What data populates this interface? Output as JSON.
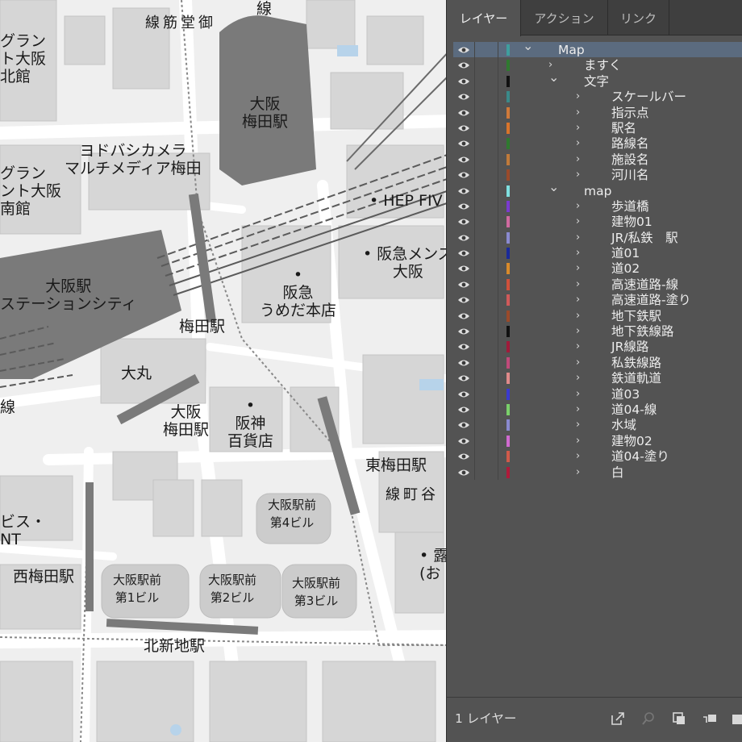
{
  "panel": {
    "tabs": [
      {
        "label": "レイヤー",
        "active": true
      },
      {
        "label": "アクション",
        "active": false
      },
      {
        "label": "リンク",
        "active": false
      }
    ],
    "layers": [
      {
        "name": "Map",
        "level": 0,
        "expanded": true,
        "color": "#3f9e9e",
        "selected": true
      },
      {
        "name": "ますく",
        "level": 1,
        "expanded": false,
        "color": "#2f7a2f"
      },
      {
        "name": "文字",
        "level": 1,
        "expanded": true,
        "color": "#111111"
      },
      {
        "name": "スケールバー",
        "level": 2,
        "expanded": false,
        "color": "#3a8a8a"
      },
      {
        "name": "指示点",
        "level": 2,
        "expanded": false,
        "color": "#d07a3a"
      },
      {
        "name": "駅名",
        "level": 2,
        "expanded": false,
        "color": "#d9742a"
      },
      {
        "name": "路線名",
        "level": 2,
        "expanded": false,
        "color": "#2f7a2f"
      },
      {
        "name": "施設名",
        "level": 2,
        "expanded": false,
        "color": "#c07a3a"
      },
      {
        "name": "河川名",
        "level": 2,
        "expanded": false,
        "color": "#9a4a2a"
      },
      {
        "name": "map",
        "level": 1,
        "expanded": true,
        "color": "#7fe0e0"
      },
      {
        "name": "歩道橋",
        "level": 2,
        "expanded": false,
        "color": "#7a3ad0"
      },
      {
        "name": "建物01",
        "level": 2,
        "expanded": false,
        "color": "#d06aa0"
      },
      {
        "name": "JR/私鉄　駅",
        "level": 2,
        "expanded": false,
        "color": "#8a8ad0"
      },
      {
        "name": "道01",
        "level": 2,
        "expanded": false,
        "color": "#1a2a9a"
      },
      {
        "name": "道02",
        "level": 2,
        "expanded": false,
        "color": "#d88a2a"
      },
      {
        "name": "高速道路-線",
        "level": 2,
        "expanded": false,
        "color": "#d0503a"
      },
      {
        "name": "高速道路-塗り",
        "level": 2,
        "expanded": false,
        "color": "#d05a5a"
      },
      {
        "name": "地下鉄駅",
        "level": 2,
        "expanded": false,
        "color": "#9a4a2a"
      },
      {
        "name": "地下鉄線路",
        "level": 2,
        "expanded": false,
        "color": "#111111"
      },
      {
        "name": "JR線路",
        "level": 2,
        "expanded": false,
        "color": "#a01a3a"
      },
      {
        "name": "私鉄線路",
        "level": 2,
        "expanded": false,
        "color": "#c04a7a"
      },
      {
        "name": "鉄道軌道",
        "level": 2,
        "expanded": false,
        "color": "#e08a8a"
      },
      {
        "name": "道03",
        "level": 2,
        "expanded": false,
        "color": "#3a3ad0"
      },
      {
        "name": "道04-線",
        "level": 2,
        "expanded": false,
        "color": "#7ad06a"
      },
      {
        "name": "水域",
        "level": 2,
        "expanded": false,
        "color": "#8a8ad0"
      },
      {
        "name": "建物02",
        "level": 2,
        "expanded": false,
        "color": "#d06ad0"
      },
      {
        "name": "道04-塗り",
        "level": 2,
        "expanded": false,
        "color": "#d05a4a"
      },
      {
        "name": "白",
        "level": 2,
        "expanded": false,
        "color": "#b01a3a"
      }
    ],
    "footer_count": "1 レイヤー",
    "colors": {
      "panel_bg": "#535353",
      "tab_bg": "#3f3f3f",
      "selected_row": "#5b6b7f"
    }
  },
  "map": {
    "labels": [
      {
        "text": "御\n堂\n筋\n線",
        "key": "midosuji-line"
      },
      {
        "text": "線",
        "key": "line-top"
      },
      {
        "text": "グラン\nト大阪\n北館",
        "key": "grand-north"
      },
      {
        "text": "大阪\n梅田駅",
        "key": "osaka-umeda-station-hankyu"
      },
      {
        "text": "ヨドバシカメラ\nマルチメディア梅田",
        "key": "yodobashi"
      },
      {
        "text": "グラン\nント大阪\n南館",
        "key": "grand-south"
      },
      {
        "text": "• HEP FIV",
        "key": "hep-five"
      },
      {
        "text": "• 阪急メンズ\n大阪",
        "key": "hankyu-mens"
      },
      {
        "text": "大阪駅\nステーションシティ",
        "key": "osaka-station-city"
      },
      {
        "text": "•\n阪急\nうめだ本店",
        "key": "hankyu-umeda"
      },
      {
        "text": "梅田駅",
        "key": "umeda-station"
      },
      {
        "text": "大丸",
        "key": "daimaru"
      },
      {
        "text": "大阪\n梅田駅",
        "key": "osaka-umeda-station-hanshin"
      },
      {
        "text": "•\n阪神\n百貨店",
        "key": "hanshin"
      },
      {
        "text": "東梅田駅",
        "key": "higashi-umeda"
      },
      {
        "text": "谷\n町\n線",
        "key": "tanimachi-line"
      },
      {
        "text": "大阪駅前\n第4ビル",
        "key": "bldg4"
      },
      {
        "text": "ビス・\nNT",
        "key": "bis-nt"
      },
      {
        "text": "西梅田駅",
        "key": "nishi-umeda"
      },
      {
        "text": "大阪駅前\n第1ビル",
        "key": "bldg1"
      },
      {
        "text": "大阪駅前\n第2ビル",
        "key": "bldg2"
      },
      {
        "text": "大阪駅前\n第3ビル",
        "key": "bldg3"
      },
      {
        "text": "• 露\n(お",
        "key": "tsuyu"
      },
      {
        "text": "北新地駅",
        "key": "kitashinchi"
      },
      {
        "text": "線",
        "key": "line-left"
      }
    ]
  }
}
